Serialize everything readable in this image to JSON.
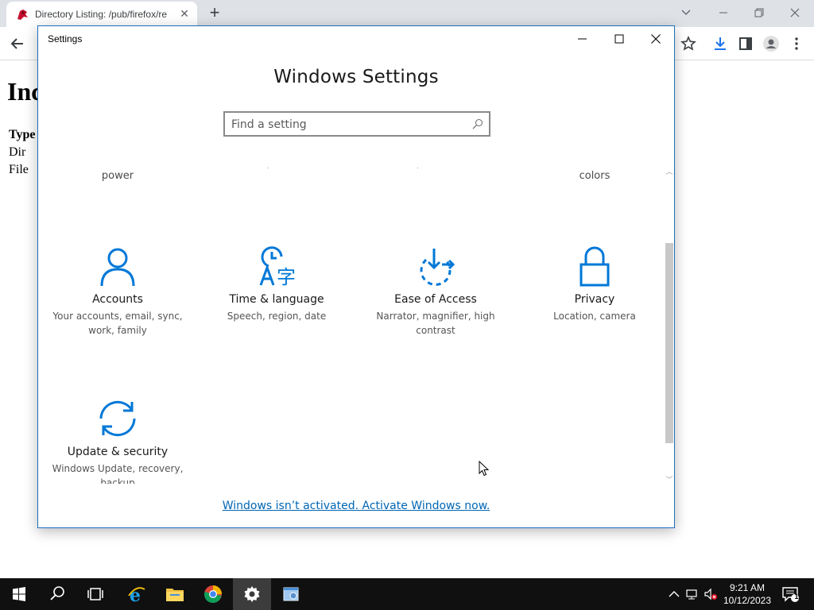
{
  "browser": {
    "tab_title": "Directory Listing: /pub/firefox/re",
    "page_heading": "Inc",
    "page_rows": [
      "Type",
      "Dir",
      "File"
    ]
  },
  "settings": {
    "window_title": "Settings",
    "heading": "Windows Settings",
    "search_placeholder": "Find a setting",
    "partial_labels": [
      "power",
      "colors"
    ],
    "tiles": [
      {
        "title": "Accounts",
        "desc": "Your accounts, email, sync, work, family",
        "icon": "person-icon"
      },
      {
        "title": "Time & language",
        "desc": "Speech, region, date",
        "icon": "time-language-icon"
      },
      {
        "title": "Ease of Access",
        "desc": "Narrator, magnifier, high contrast",
        "icon": "ease-of-access-icon"
      },
      {
        "title": "Privacy",
        "desc": "Location, camera",
        "icon": "lock-icon"
      },
      {
        "title": "Update & security",
        "desc": "Windows Update, recovery, backup",
        "icon": "sync-icon"
      }
    ],
    "activate_link": "Windows isn’t activated. Activate Windows now."
  },
  "taskbar": {
    "time": "9:21 AM",
    "date": "10/12/2023",
    "notification_count": "1"
  },
  "colors": {
    "accent": "#0078d7",
    "link": "#0066b4",
    "taskbar": "#101010"
  }
}
